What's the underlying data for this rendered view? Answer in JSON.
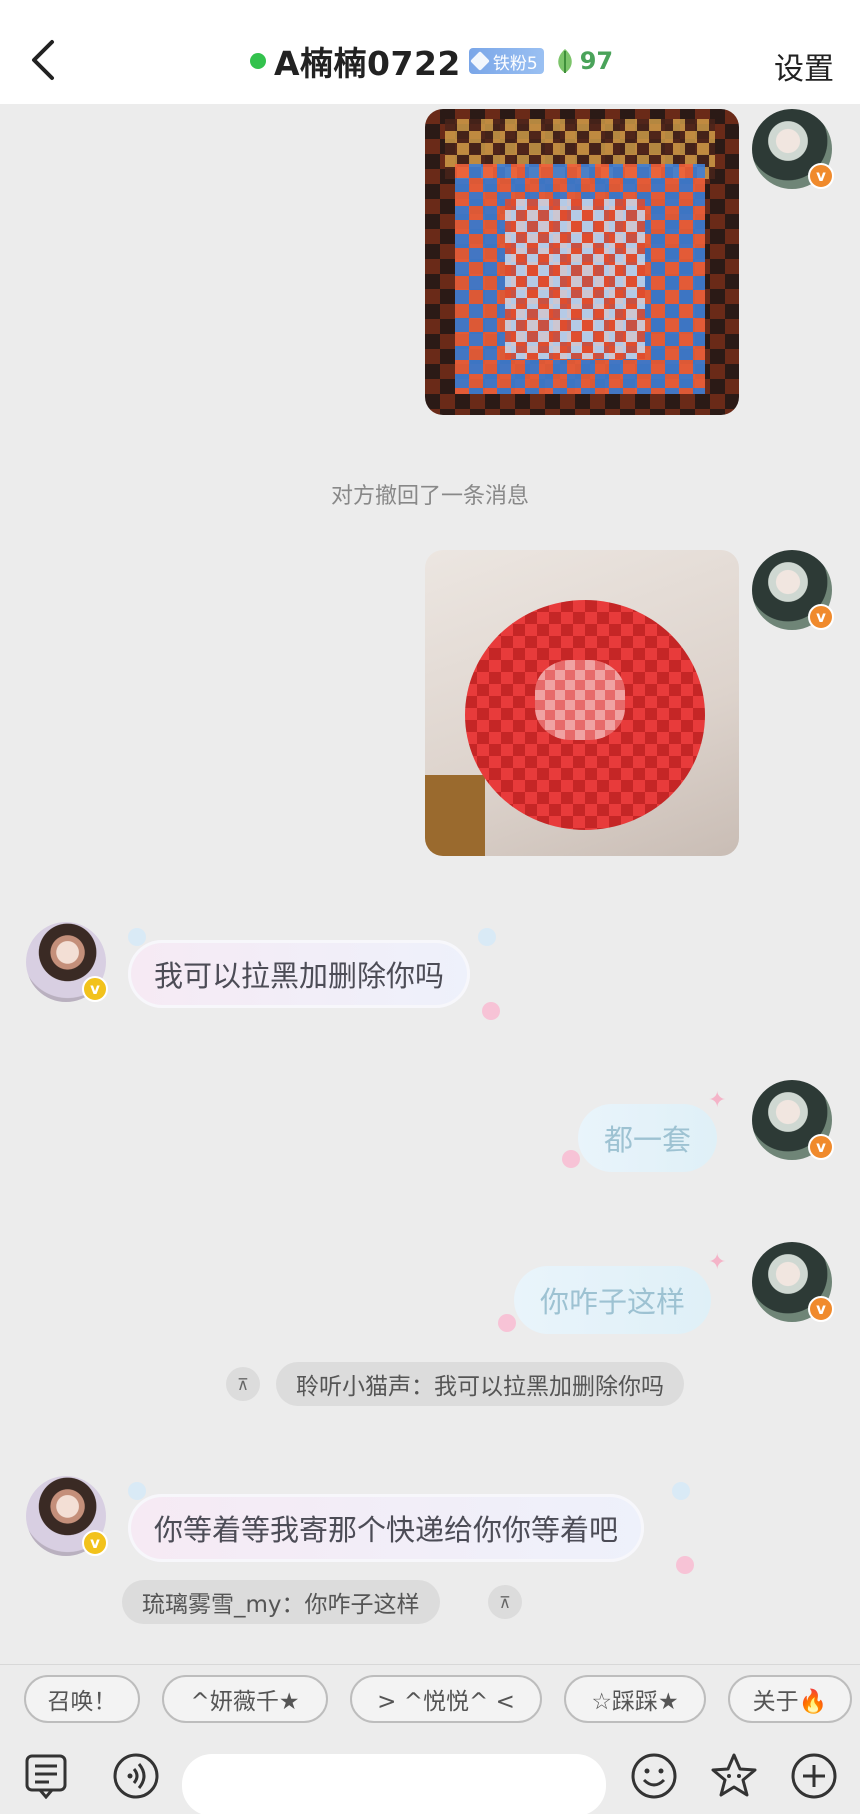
{
  "header": {
    "title": "A楠楠0722",
    "fan_badge": "铁粉5",
    "leaf_level": "97",
    "settings_label": "设置"
  },
  "system_message": "对方撤回了一条消息",
  "messages": {
    "peer_1": "我可以拉黑加删除你吗",
    "me_1": "都一套",
    "me_2": "你咋子这样",
    "quote_1": "聆听小猫声：我可以拉黑加删除你吗",
    "peer_2": "你等着等我寄那个快递给你你等着吧",
    "quote_2": "琉璃雾雪_my：你咋子这样"
  },
  "quick_replies": [
    "召唤！",
    "^妍薇千★",
    "> ^悦悦^ <",
    "☆踩踩★",
    "关于🔥"
  ],
  "icons": {
    "back": "chevron-left-icon",
    "document": "document-icon",
    "voice": "voice-icon",
    "emoji": "smile-icon",
    "sticker": "star-icon",
    "add": "plus-circle-icon"
  },
  "colors": {
    "online": "#33c24d",
    "fan_badge": "#7aa6e8",
    "leaf": "#4aa35a",
    "me_vbadge": "#f08a2c",
    "peer_vbadge": "#f2c21b"
  }
}
